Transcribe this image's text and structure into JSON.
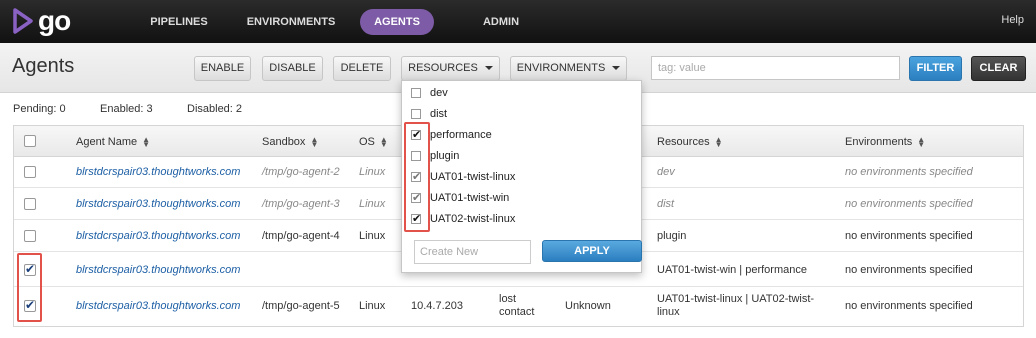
{
  "app": {
    "logo_text": "go"
  },
  "nav": {
    "items": [
      "PIPELINES",
      "ENVIRONMENTS",
      "AGENTS",
      "ADMIN"
    ],
    "active": "AGENTS",
    "help": "Help"
  },
  "header": {
    "title": "Agents",
    "buttons": {
      "enable": "ENABLE",
      "disable": "DISABLE",
      "delete": "DELETE",
      "resources": "RESOURCES",
      "environments": "ENVIRONMENTS"
    },
    "tag_placeholder": "tag: value",
    "filter": "FILTER",
    "clear": "CLEAR"
  },
  "summary": {
    "pending": "Pending: 0",
    "enabled": "Enabled: 3",
    "disabled": "Disabled: 2"
  },
  "table": {
    "columns": [
      "Agent Name",
      "Sandbox",
      "OS",
      "Resources",
      "Environments"
    ],
    "rows": [
      {
        "name": "blrstdcrspair03.thoughtworks.com",
        "sandbox": "/tmp/go-agent-2",
        "os": "Linux",
        "ip": "",
        "status": "",
        "free": "",
        "resources": "dev",
        "environments": "no environments specified",
        "checked": false,
        "disabled": true
      },
      {
        "name": "blrstdcrspair03.thoughtworks.com",
        "sandbox": "/tmp/go-agent-3",
        "os": "Linux",
        "ip": "",
        "status": "",
        "free": "",
        "resources": "dist",
        "environments": "no environments specified",
        "checked": false,
        "disabled": true
      },
      {
        "name": "blrstdcrspair03.thoughtworks.com",
        "sandbox": "/tmp/go-agent-4",
        "os": "Linux",
        "ip": "",
        "status": "",
        "free": "",
        "resources": "plugin",
        "environments": "no environments specified",
        "checked": false,
        "disabled": false
      },
      {
        "name": "blrstdcrspair03.thoughtworks.com",
        "sandbox": "",
        "os": "",
        "ip": "",
        "status": "",
        "free": "",
        "resources": "UAT01-twist-win | performance",
        "environments": "no environments specified",
        "checked": true,
        "disabled": false
      },
      {
        "name": "blrstdcrspair03.thoughtworks.com",
        "sandbox": "/tmp/go-agent-5",
        "os": "Linux",
        "ip": "10.4.7.203",
        "status": "lost contact",
        "free": "Unknown",
        "resources": "UAT01-twist-linux | UAT02-twist-linux",
        "environments": "no environments specified",
        "checked": true,
        "disabled": false
      }
    ]
  },
  "resources_dropdown": {
    "items": [
      {
        "label": "dev",
        "state": "unchecked"
      },
      {
        "label": "dist",
        "state": "unchecked"
      },
      {
        "label": "performance",
        "state": "checked"
      },
      {
        "label": "plugin",
        "state": "unchecked"
      },
      {
        "label": "UAT01-twist-linux",
        "state": "partial"
      },
      {
        "label": "UAT01-twist-win",
        "state": "partial"
      },
      {
        "label": "UAT02-twist-linux",
        "state": "checked"
      }
    ],
    "create_placeholder": "Create New",
    "apply": "APPLY"
  },
  "colors": {
    "accent": "#7d5ba6",
    "link": "#1d5fa5",
    "filter": "#2b7fbf",
    "highlight": "#e2524a"
  }
}
